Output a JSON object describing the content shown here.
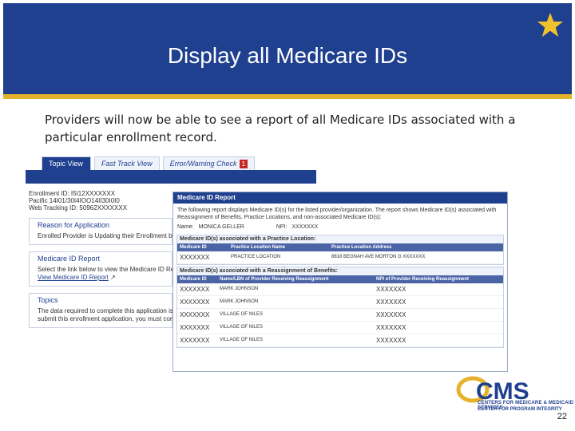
{
  "slide": {
    "title": "Display all Medicare IDs",
    "body_line1": "Providers will now be able to see a report of all Medicare IDs associated with a",
    "body_line2": "particular enrollment record.",
    "page_number": "22",
    "accent_color": "#1f3f8f",
    "gold_color": "#e5b22c"
  },
  "tabs": [
    {
      "label": "Topic View"
    },
    {
      "label": "Fast Track View"
    },
    {
      "label": "Error/Warning Check",
      "badge": "1"
    }
  ],
  "left_panel": {
    "lines": [
      "Enrollment ID: I5I12XXXXXXX",
      "Pacific 14I01/30I4IOO14II30I0I0",
      "Web Tracking ID: 50962XXXXXXX"
    ],
    "reason_heading": "Reason for Application",
    "reason_text": "Enrolled Provider is Updating their Enrollment by",
    "medicare_heading": "Medicare ID Report",
    "medicare_text": "Select the link below to view the Medicare ID Rep",
    "medicare_link": "View Medicare ID Report",
    "topics_heading": "Topics",
    "topics_line1": "The data required to complete this application is",
    "topics_line2": "submit this enrollment application, you must comp"
  },
  "report": {
    "header": "Medicare ID Report",
    "desc_line1": "The following report displays Medicare ID(s) for the listed provider/organization. The report shows Medicare ID(s) associated with",
    "desc_line2": "Reassignment of Benefits, Practice Locations, and non-associated Medicare ID(s):",
    "name_label": "Name:",
    "name_value": "MONICA GELLER",
    "npi_label": "NPI:",
    "npi_value": "XXXXXXX",
    "section1": {
      "title": "Medicare ID(s) associated with a Practice Location:",
      "columns": [
        "Medicare ID",
        "Practice Location Name",
        "Practice Location Address"
      ],
      "rows": [
        [
          "XXXXXXX",
          "PRACTICE LOCATION",
          "8818 BEGNAH AVE MORTON G XXXXXXX"
        ]
      ]
    },
    "section2": {
      "title": "Medicare ID(s) associated with a Reassignment of Benefits:",
      "columns": [
        "Medicare ID",
        "Name/LBN of Provider Receiving Reassignment",
        "NPI of Provider Receiving Reassignment"
      ],
      "rows": [
        [
          "XXXXXXX",
          "MARK JOHNSON",
          "XXXXXXX"
        ],
        [
          "XXXXXXX",
          "MARK JOHNSON",
          "XXXXXXX"
        ],
        [
          "XXXXXXX",
          "VILLAGE OF NILES",
          "XXXXXXX"
        ],
        [
          "XXXXXXX",
          "VILLAGE OF NILES",
          "XXXXXXX"
        ],
        [
          "XXXXXXX",
          "VILLAGE OF NILES",
          "XXXXXXX"
        ]
      ]
    }
  },
  "logo": {
    "text": "CMS",
    "sub1": "CENTERS FOR MEDICARE & MEDICAID SERVICES",
    "sub2": "CENTER FOR PROGRAM INTEGRITY"
  }
}
